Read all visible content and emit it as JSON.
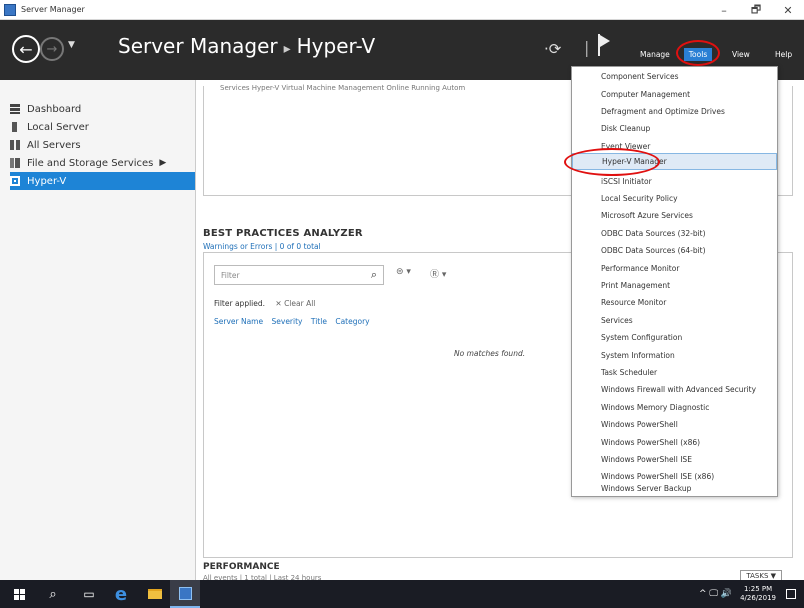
{
  "window": {
    "title": "Server Manager",
    "controls": {
      "minimize": "–",
      "maximize": "🗗",
      "close": "✕"
    }
  },
  "header": {
    "breadcrumb_root": "Server Manager",
    "breadcrumb_sep": "▸",
    "breadcrumb_current": "Hyper-V",
    "menu": {
      "manage": "Manage",
      "tools": "Tools",
      "view": "View",
      "help": "Help"
    },
    "refresh_symbol": "·⟳",
    "separator": "|"
  },
  "sidebar": {
    "items": [
      {
        "label": "Dashboard",
        "icon": "dashboard-icon"
      },
      {
        "label": "Local Server",
        "icon": "local-server-icon"
      },
      {
        "label": "All Servers",
        "icon": "all-servers-icon"
      },
      {
        "label": "File and Storage Services",
        "icon": "file-storage-icon",
        "arrow": "▶"
      },
      {
        "label": "Hyper-V",
        "icon": "hyper-v-icon",
        "selected": true
      }
    ]
  },
  "main": {
    "top_panel_clipped": "Services     Hyper-V Virtual Machine Management  Online          Running  Autom",
    "bpa": {
      "title": "BEST PRACTICES ANALYZER",
      "subtitle": "Warnings or Errors | 0 of 0 total",
      "filter_placeholder": "Filter",
      "filter_applied": "Filter applied.",
      "clear_all": "✕  Clear All",
      "columns": [
        "Server Name",
        "Severity",
        "Title",
        "Category"
      ],
      "empty_message": "No matches found."
    },
    "performance": {
      "title": "PERFORMANCE",
      "subtitle": "All events | 1 total | Last 24 hours",
      "tasks_label": "TASKS  ▼"
    }
  },
  "tools_menu": {
    "highlighted": "Hyper-V Manager",
    "items": [
      "Component Services",
      "Computer Management",
      "Defragment and Optimize Drives",
      "Disk Cleanup",
      "Event Viewer",
      "Hyper-V Manager",
      "iSCSI Initiator",
      "Local Security Policy",
      "Microsoft Azure Services",
      "ODBC Data Sources (32-bit)",
      "ODBC Data Sources (64-bit)",
      "Performance Monitor",
      "Print Management",
      "Resource Monitor",
      "Services",
      "System Configuration",
      "System Information",
      "Task Scheduler",
      "Windows Firewall with Advanced Security",
      "Windows Memory Diagnostic",
      "Windows PowerShell",
      "Windows PowerShell (x86)",
      "Windows PowerShell ISE",
      "Windows PowerShell ISE (x86)",
      "Windows Server Backup"
    ]
  },
  "taskbar": {
    "time": "1:25 PM",
    "date": "4/26/2019",
    "tray_symbols": "^  🖵  🔊"
  },
  "colors": {
    "header_bg": "#2b2b2b",
    "accent": "#1e84d6",
    "annotation": "#e01010",
    "taskbar_bg": "#1a1c24"
  }
}
